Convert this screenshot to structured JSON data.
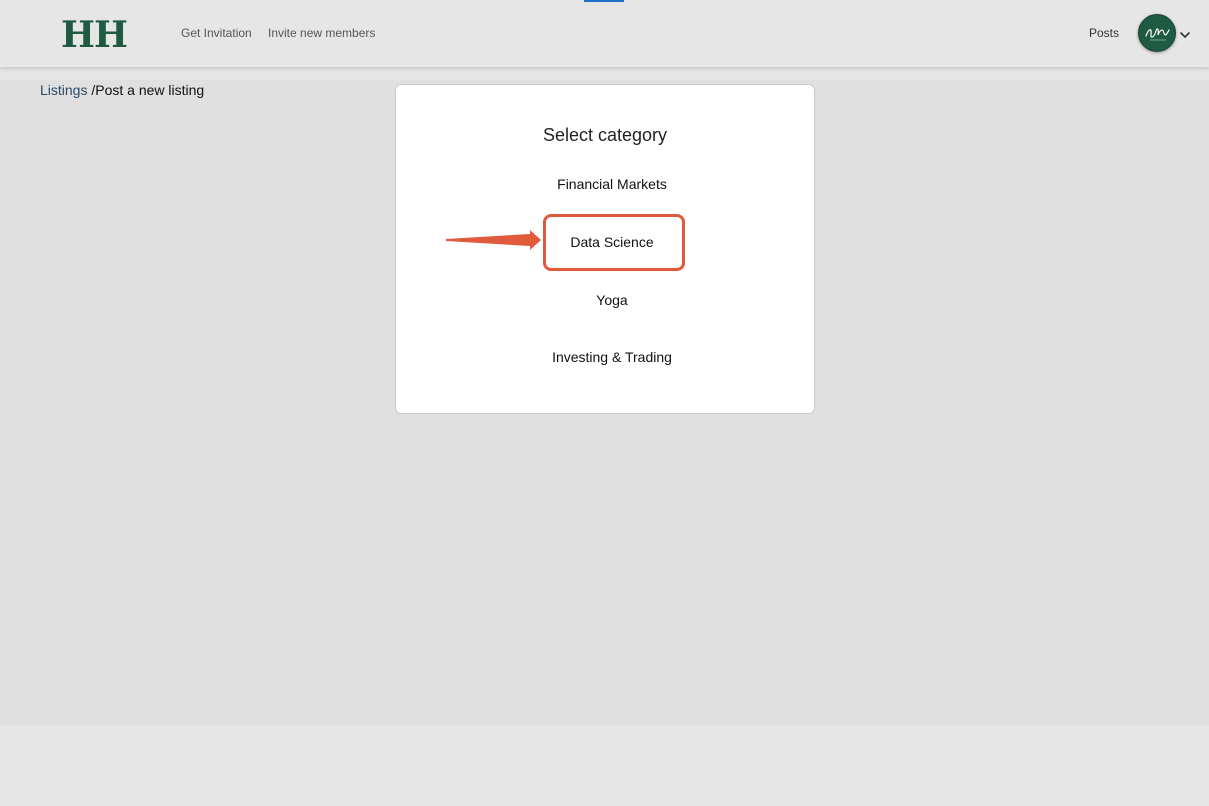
{
  "header": {
    "logo_text": "HH",
    "nav": {
      "get_invitation": "Get Invitation",
      "invite_members": "Invite new members",
      "posts": "Posts"
    }
  },
  "breadcrumb": {
    "listings": "Listings",
    "separator": " /",
    "current": "Post a new listing"
  },
  "dialog": {
    "title": "Select category",
    "categories": [
      "Financial Markets",
      "Data Science",
      "Yoga",
      "Investing & Trading"
    ],
    "highlighted": "Data Science"
  },
  "colors": {
    "brand": "#1f5a43",
    "highlight": "#e25a3c",
    "accent": "#1e6fc8"
  },
  "icons": {
    "avatar": "user-avatar",
    "menu": "chevron-down-icon",
    "pointer": "red-arrow-annotation"
  }
}
